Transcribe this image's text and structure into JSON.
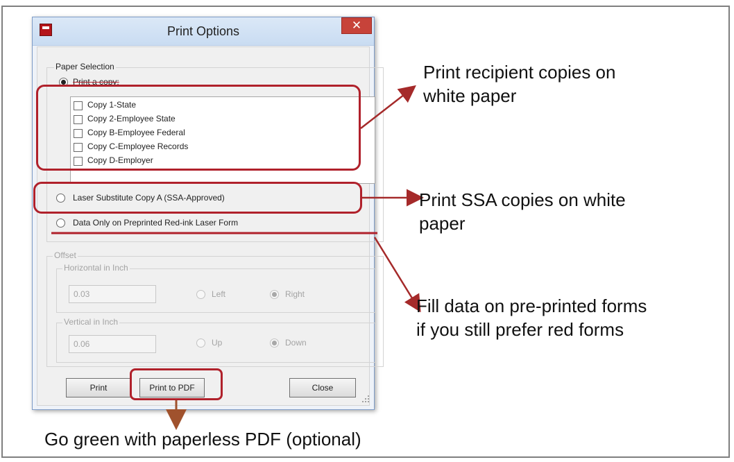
{
  "dialog": {
    "title": "Print Options",
    "close_label": "✕",
    "paper_selection": {
      "label": "Paper Selection",
      "print_copy_label": "Print a copy:",
      "print_copy_selected": true,
      "copies": [
        {
          "label": "Copy 1-State",
          "checked": false
        },
        {
          "label": "Copy 2-Employee State",
          "checked": false
        },
        {
          "label": "Copy B-Employee Federal",
          "checked": false
        },
        {
          "label": "Copy C-Employee Records",
          "checked": false
        },
        {
          "label": "Copy D-Employer",
          "checked": false
        }
      ],
      "laser_sub_label": "Laser Substitute Copy A (SSA-Approved)",
      "data_only_label": "Data Only on Preprinted Red-ink Laser Form"
    },
    "offset": {
      "label": "Offset",
      "horizontal": {
        "label": "Horizontal in Inch",
        "value": "0.03",
        "left_label": "Left",
        "right_label": "Right",
        "selected": "Right"
      },
      "vertical": {
        "label": "Vertical in Inch",
        "value": "0.06",
        "up_label": "Up",
        "down_label": "Down",
        "selected": "Down"
      }
    },
    "buttons": {
      "print": "Print",
      "print_pdf": "Print to PDF",
      "close": "Close"
    }
  },
  "annotations": {
    "recipient": [
      "Print recipient copies on",
      "white paper"
    ],
    "ssa": [
      "Print SSA copies on white",
      "paper"
    ],
    "fill": [
      "Fill data on pre-printed forms",
      "if you still prefer red forms"
    ],
    "pdf": "Go green with paperless PDF  (optional)"
  },
  "colors": {
    "highlight": "#b0212b",
    "arrow_red": "#a52a2a",
    "arrow_brown": "#a0522d"
  }
}
